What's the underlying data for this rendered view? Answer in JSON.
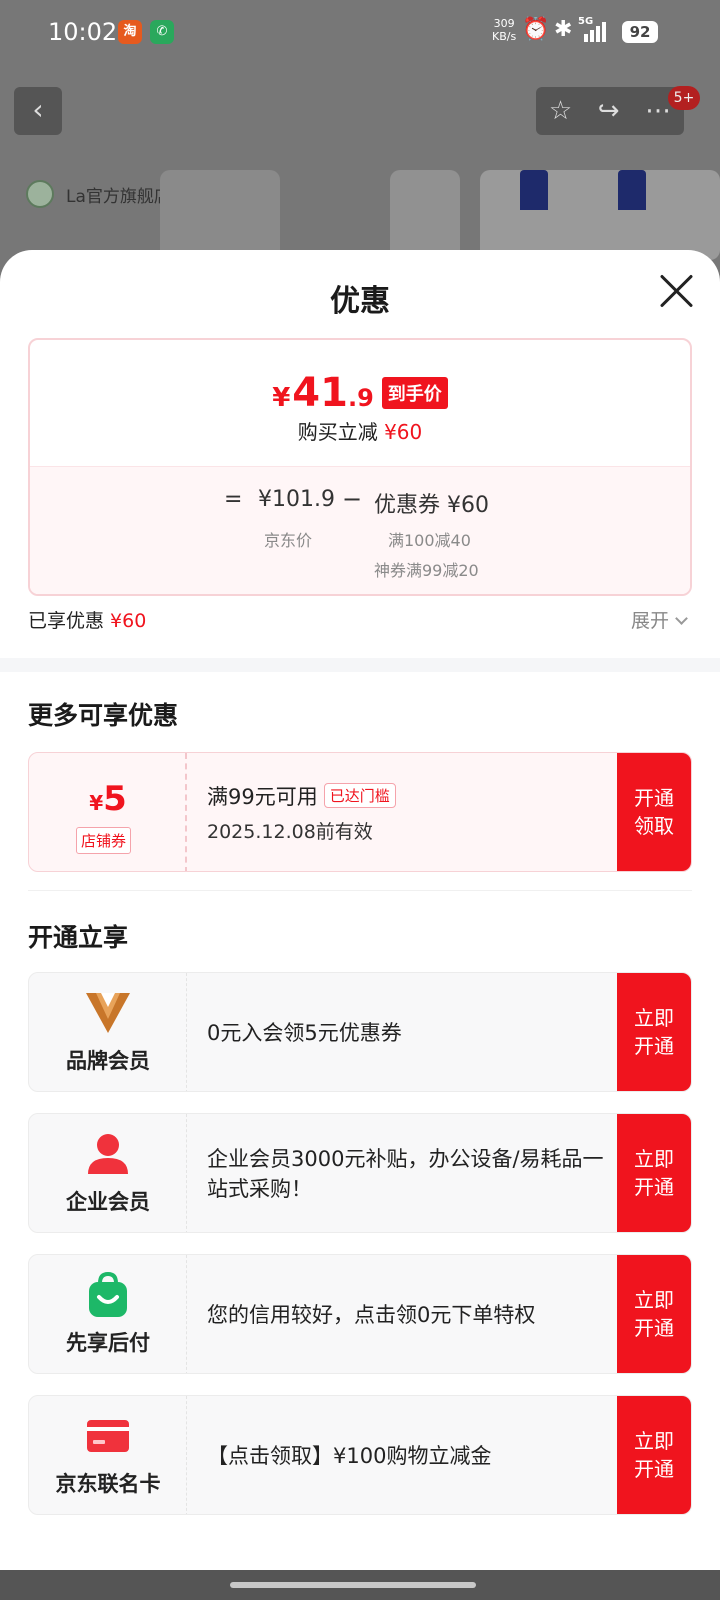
{
  "status_bar": {
    "time": "10:02",
    "app1": "淘",
    "app2": "✆",
    "net_speed_value": "309",
    "net_speed_unit": "KB/s",
    "network": "5G",
    "battery": "92"
  },
  "background": {
    "store_name": "La官方旗舰店",
    "cart_badge": "5+"
  },
  "sheet": {
    "title": "优惠"
  },
  "price_card": {
    "currency": "¥",
    "price_int": "41",
    "price_dec": ".9",
    "price_tag": "到手价",
    "discount_label": "购买立减",
    "discount_value": "¥60",
    "eq": "=",
    "jd_price": "¥101.9",
    "minus": "−",
    "coupon_total": "优惠券 ¥60",
    "jd_price_label": "京东价",
    "coupon_line1": "满100减40",
    "coupon_line2": "神券满99减20"
  },
  "enjoyed": {
    "label": "已享优惠",
    "value": "¥60",
    "expand_label": "展开"
  },
  "more_offers": {
    "title": "更多可享优惠",
    "coupon": {
      "currency": "¥",
      "amount": "5",
      "type": "店铺券",
      "condition": "满99元可用",
      "badge": "已达门槛",
      "expiry": "2025.12.08前有效",
      "button": "开通领取"
    }
  },
  "open_enjoy": {
    "title": "开通立享",
    "items": [
      {
        "name": "品牌会员",
        "desc": "0元入会领5元优惠券",
        "button": "立即开通"
      },
      {
        "name": "企业会员",
        "desc": "企业会员3000元补贴，办公设备/易耗品一站式采购！",
        "button": "立即开通"
      },
      {
        "name": "先享后付",
        "desc": "您的信用较好，点击领0元下单特权",
        "button": "立即开通"
      },
      {
        "name": "京东联名卡",
        "desc": "【点击领取】¥100购物立减金",
        "button": "立即开通"
      }
    ]
  },
  "colors": {
    "accent_red": "#f0141e",
    "card_pink_bg": "#fff6f7",
    "brand_gold": "#c8762a"
  },
  "icons": {
    "brand_member": "brand-v-icon",
    "enterprise_member": "person-icon",
    "pay_later": "shopping-bag-icon",
    "co_brand_card": "credit-card-icon"
  }
}
